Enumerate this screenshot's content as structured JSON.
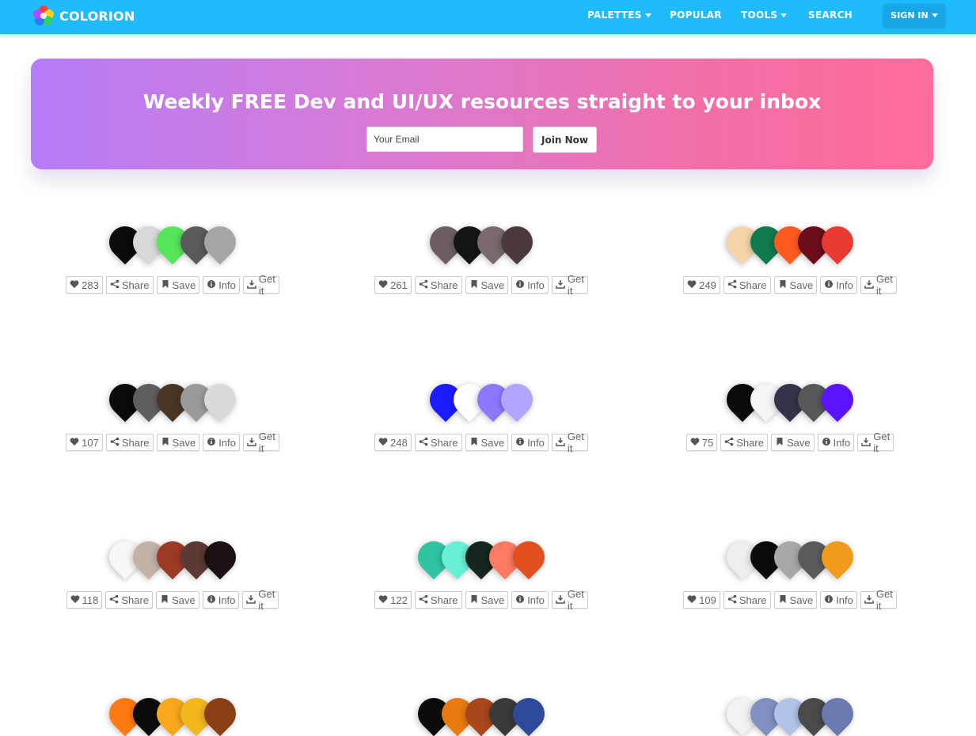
{
  "nav": {
    "brand": "COLORION",
    "items": [
      "PALETTES",
      "POPULAR",
      "TOOLS",
      "SEARCH"
    ],
    "signin": "SIGN IN"
  },
  "banner": {
    "title": "Weekly FREE Dev and UI/UX resources straight to your inbox",
    "email_placeholder": "Your Email",
    "join_label": "Join Now"
  },
  "action_labels": {
    "share": "Share",
    "save": "Save",
    "info": "Info",
    "get": "Get it"
  },
  "palettes": [
    {
      "likes": "283",
      "colors": [
        "#0b0b0b",
        "#d9d9d9",
        "#55e65a",
        "#5a5a5a",
        "#a6a6a6"
      ]
    },
    {
      "likes": "261",
      "colors": [
        "#6e5e61",
        "#141414",
        "#7a6a6d",
        "#4a3a3c"
      ]
    },
    {
      "likes": "249",
      "colors": [
        "#f4d4a8",
        "#0e7a4d",
        "#ff5a1f",
        "#6b0d1a",
        "#e83a30"
      ]
    },
    {
      "likes": "107",
      "colors": [
        "#0b0b0b",
        "#5f5f5f",
        "#4a3525",
        "#9a9a9a",
        "#dadada"
      ]
    },
    {
      "likes": "248",
      "colors": [
        "#1b1bff",
        "#ffffff",
        "#8c78ff",
        "#b1a6ff"
      ]
    },
    {
      "likes": "75",
      "colors": [
        "#0b0b0b",
        "#f5f5f5",
        "#33334a",
        "#585858",
        "#5b14ff"
      ]
    },
    {
      "likes": "118",
      "colors": [
        "#f7f7f7",
        "#c2b2a8",
        "#9c3b25",
        "#5a3a33",
        "#1a1212"
      ]
    },
    {
      "likes": "122",
      "colors": [
        "#2fc4a2",
        "#67f0d4",
        "#17261f",
        "#ff7a63",
        "#e3501f"
      ]
    },
    {
      "likes": "109",
      "colors": [
        "#eeeeee",
        "#0b0b0b",
        "#a8a8a8",
        "#5a5a5a",
        "#f29a1c"
      ]
    },
    {
      "colors": [
        "#ff7a10",
        "#0b0b0b",
        "#f7a81d",
        "#f2b71d",
        "#8a4014"
      ]
    },
    {
      "colors": [
        "#0b0b0b",
        "#e87a10",
        "#a8461c",
        "#3a3a3a",
        "#2d4a9a"
      ]
    },
    {
      "colors": [
        "#f2f2f2",
        "#8090c0",
        "#b0c4e8",
        "#4a4a4a",
        "#6a7ab0"
      ]
    }
  ]
}
